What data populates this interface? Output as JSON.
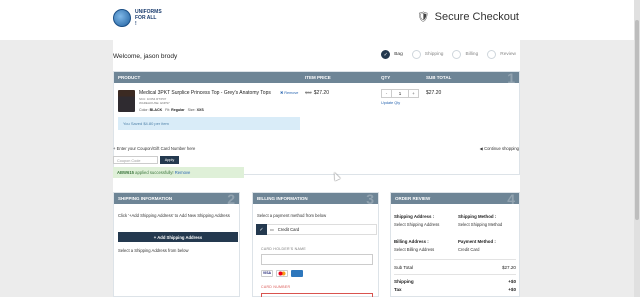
{
  "brand": {
    "logo_text": "UNIFORMS FOR ALL !",
    "secure_label": "Secure Checkout"
  },
  "welcome": "Welcome, jason brody",
  "steps": [
    {
      "label": "Bag",
      "active": true
    },
    {
      "label": "Shipping",
      "active": false
    },
    {
      "label": "Billing",
      "active": false
    },
    {
      "label": "Review",
      "active": false
    }
  ],
  "cart": {
    "headers": {
      "product": "PRODUCT",
      "item_price": "ITEM PRICE",
      "qty": "QTY",
      "subtotal": "SUB TOTAL",
      "num": "1"
    },
    "item": {
      "name": "Medical 3PKT Surplice Princess Top - Grey's Anatomy Tops",
      "sku": "SKU: 1F054 RT/P07",
      "warehouse": "WAREHOUSE: ENP97",
      "variants": {
        "color_label": "Color:",
        "color": "BLACK",
        "fit_label": "Fit:",
        "fit": "Regular",
        "size_label": "Size:",
        "size": "XXS"
      },
      "remove": "Remove",
      "old_price": "$32",
      "price": "$27.20",
      "qty": "1",
      "minus": "-",
      "plus": "+",
      "update": "Update Qty",
      "subtotal": "$27.20"
    },
    "saved_msg": "You Saved $4.80 per item"
  },
  "coupon": {
    "link": "+ Enter your Coupon/Gift Card Number here",
    "placeholder": "Coupon Code",
    "apply": "Apply",
    "success_code": "ABW615",
    "success_text": " applied successfully! ",
    "remove": "Remove"
  },
  "continue_shopping": "Continue shopping",
  "shipping": {
    "title": "SHIPPING INFORMATION",
    "num": "2",
    "instruction": "Click '+Add Shipping Address' to Add New Shipping Address",
    "add_button": "+ Add Shipping Address",
    "select_text": "Select a Shipping Address from below"
  },
  "billing": {
    "title": "BILLING INFORMATION",
    "num": "3",
    "instruction": "Select a payment method from below",
    "method": "Credit Card",
    "holder_label": "CARD HOLDER'S NAME",
    "number_label": "CARD NUMBER"
  },
  "review": {
    "title": "ORDER REVIEW",
    "num": "4",
    "shipping_address_label": "Shipping Address :",
    "shipping_address_val": "Select Shipping Address",
    "shipping_method_label": "Shipping Method :",
    "shipping_method_val": "Select Shipping Method",
    "billing_address_label": "Billing Address :",
    "billing_address_val": "Select Billing Address",
    "payment_method_label": "Payment Method :",
    "payment_method_val": "Credit Card",
    "subtotal_label": "Sub Total",
    "subtotal_val": "$27.20",
    "shipping_label": "Shipping",
    "shipping_val": "+$0",
    "tax_label": "Tax",
    "tax_val": "+$0"
  },
  "colors": {
    "nav_dark": "#24394f",
    "table_head": "#6e8596",
    "link": "#2a66b1",
    "success_bg": "#dff0d8",
    "info_bg": "#d9ecf8"
  }
}
